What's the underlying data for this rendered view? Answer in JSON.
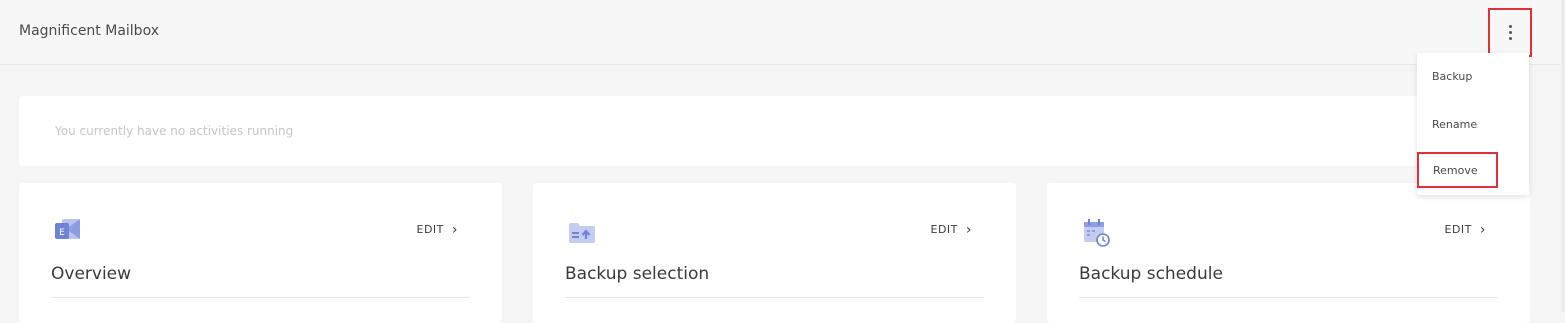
{
  "header": {
    "title": "Magnificent Mailbox",
    "more_icon": "more-vertical-icon"
  },
  "activity": {
    "message": "You currently have no activities running"
  },
  "cards": [
    {
      "icon": "exchange-mailbox-icon",
      "edit_label": "EDIT",
      "title": "Overview"
    },
    {
      "icon": "folder-upload-icon",
      "edit_label": "EDIT",
      "title": "Backup selection"
    },
    {
      "icon": "calendar-clock-icon",
      "edit_label": "EDIT",
      "title": "Backup schedule"
    }
  ],
  "menu": {
    "items": [
      {
        "label": "Backup"
      },
      {
        "label": "Rename"
      },
      {
        "label": "Remove"
      }
    ]
  },
  "colors": {
    "accent_icon": "#6f82d8",
    "highlight_border": "#e0313a"
  }
}
